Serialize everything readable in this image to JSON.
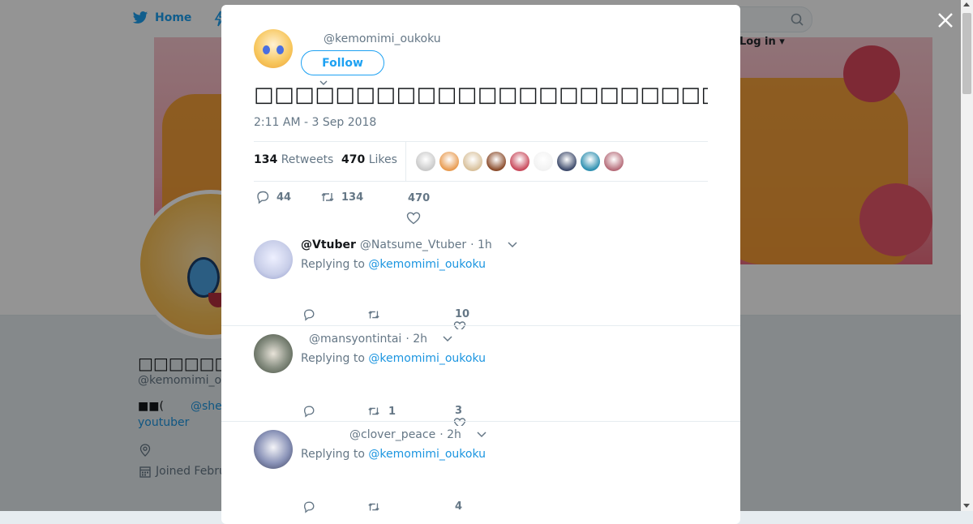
{
  "nav": {
    "home_label": "Home",
    "login_label": "Log in"
  },
  "profile": {
    "name": "□□□□□□□□□□",
    "handle": "@kemomimi_o",
    "bio_line1": "■■(",
    "bio_link": "@she",
    "bio_line2": "youtuber",
    "joined": "Joined Febru"
  },
  "tweet": {
    "handle": "@kemomimi_oukoku",
    "follow_label": "Follow",
    "text": "□□□□□□□□□□□□□□□□□□□□□□□□□□□□□□□□□□",
    "timestamp": "2:11 AM - 3 Sep 2018",
    "retweets_count": "134",
    "retweets_label": "Retweets",
    "likes_count": "470",
    "likes_label": "Likes",
    "reply_count": "44",
    "retweet_action_count": "134",
    "like_action_count": "470",
    "liker_colors": [
      "#c9c9c9",
      "#e89a4f",
      "#d8c09a",
      "#8a4b2b",
      "#c8485a",
      "#f2f2f2",
      "#3d4a6b",
      "#2d8fb0",
      "#b56b78"
    ]
  },
  "replies": [
    {
      "name": "@Vtuber",
      "handle": "@Natsume_Vtuber",
      "time": "· 1h",
      "replying_prefix": "Replying to",
      "replying_to": "@kemomimi_oukoku",
      "retweets": "",
      "likes": "10",
      "avatar_color": "#c7cde8"
    },
    {
      "name": "",
      "handle": "@mansyontintai",
      "time": "· 2h",
      "replying_prefix": "Replying to",
      "replying_to": "@kemomimi_oukoku",
      "retweets": "1",
      "likes": "3",
      "avatar_color": "#5a6a55"
    },
    {
      "name": "",
      "handle": "@clover_peace",
      "time": "· 2h",
      "replying_prefix": "Replying to",
      "replying_to": "@kemomimi_oukoku",
      "retweets": "",
      "likes": "4",
      "avatar_color": "#8a93b8"
    }
  ],
  "colors": {
    "accent": "#1da1f2",
    "link": "#1b95e0",
    "muted": "#657786"
  }
}
